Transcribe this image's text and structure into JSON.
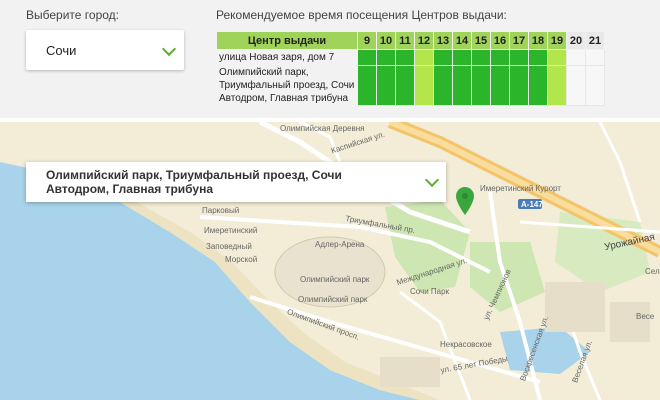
{
  "city": {
    "label": "Выберите город:",
    "selected": "Сочи"
  },
  "schedule": {
    "title": "Рекомендуемое время посещения Центров выдачи:",
    "header_label": "Центр выдачи",
    "hours": [
      "9",
      "10",
      "11",
      "12",
      "13",
      "14",
      "15",
      "16",
      "17",
      "18",
      "19",
      "20",
      "21"
    ],
    "rows": [
      {
        "name": "улица Новая заря, дом 7",
        "levels": [
          "g",
          "g",
          "g",
          "y",
          "g",
          "g",
          "g",
          "g",
          "g",
          "g",
          "y",
          "w",
          "w"
        ]
      },
      {
        "name": "Олимпийский парк, Триумфальный проезд, Сочи Автодром, Главная трибуна",
        "levels": [
          "g",
          "g",
          "g",
          "y",
          "g",
          "g",
          "g",
          "g",
          "g",
          "g",
          "y",
          "w",
          "w"
        ]
      }
    ],
    "colors": {
      "green": "#2ab52a",
      "light_green": "#b2e64a",
      "free": "#f7f7f7"
    }
  },
  "map": {
    "selected_point": "Олимпийский парк, Триумфальный проезд, Сочи Автодром, Главная трибуна",
    "pin_icon": "map-pin-icon",
    "labels": {
      "caspian_street": "Каспийская ул.",
      "olymp_village": "Олимпийская Деревня",
      "imeretinsky_resort": "Имеретинский Курорт",
      "road": "А-147",
      "urozhainaya": "Урожайная",
      "sele": "Селе",
      "vese": "Весе",
      "park": "Парковый",
      "imeretinsky": "Имеретинский",
      "zapovedny": "Заповедный",
      "morskoy": "Морской",
      "triumph": "Триумфальный пр.",
      "adler_arena": "Адлер-Арена",
      "olymp_park": "Олимпийский парк",
      "olymp_park2": "Олимпийский парк",
      "sochi_park": "Сочи Парк",
      "international": "Международная ул.",
      "chempionov": "ул. Чемпионов",
      "voskr": "Воскресенская ул.",
      "olymp_prosp": "Олимпийский просп.",
      "nekrasov": "Некрасовское",
      "pobedy": "ул. 65 лет Победы",
      "vesely": "Веселая ул."
    }
  }
}
